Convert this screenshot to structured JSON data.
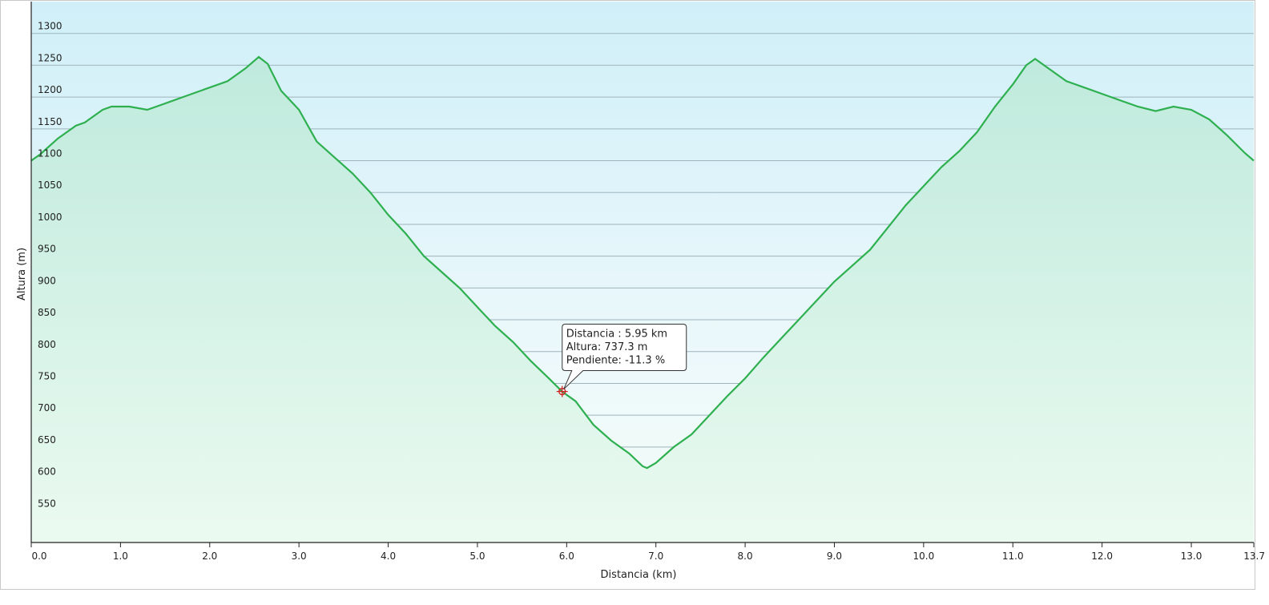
{
  "chart_data": {
    "type": "area",
    "title": "",
    "xlabel": "Distancia  (km)",
    "ylabel": "Altura (m)",
    "xlim": [
      0,
      13.7
    ],
    "ylim": [
      500,
      1350
    ],
    "x_ticks": [
      "0.0",
      "1.0",
      "2.0",
      "3.0",
      "4.0",
      "5.0",
      "6.0",
      "7.0",
      "8.0",
      "9.0",
      "10.0",
      "11.0",
      "12.0",
      "13.0",
      "13.7"
    ],
    "y_ticks": [
      "1300",
      "1250",
      "1200",
      "1150",
      "1100",
      "1050",
      "1000",
      "950",
      "900",
      "850",
      "800",
      "750",
      "700",
      "650",
      "600",
      "550"
    ],
    "grid": true,
    "line_color": "#2eb050",
    "series": [
      {
        "x": [
          0.0,
          0.1,
          0.3,
          0.5,
          0.6,
          0.8,
          0.9,
          1.0,
          1.1,
          1.3,
          1.5,
          1.7,
          2.0,
          2.2,
          2.4,
          2.55,
          2.65,
          2.8,
          3.0,
          3.2,
          3.4,
          3.6,
          3.8,
          4.0,
          4.2,
          4.4,
          4.6,
          4.8,
          5.0,
          5.2,
          5.4,
          5.6,
          5.8,
          5.95,
          6.1,
          6.3,
          6.5,
          6.7,
          6.85,
          6.9,
          7.0,
          7.2,
          7.4,
          7.6,
          7.8,
          8.0,
          8.2,
          8.4,
          8.6,
          8.8,
          9.0,
          9.2,
          9.4,
          9.6,
          9.8,
          10.0,
          10.2,
          10.4,
          10.6,
          10.8,
          11.0,
          11.15,
          11.25,
          11.4,
          11.6,
          11.8,
          12.0,
          12.2,
          12.4,
          12.6,
          12.8,
          13.0,
          13.2,
          13.4,
          13.6,
          13.7
        ],
        "y": [
          1100,
          1110,
          1135,
          1155,
          1160,
          1180,
          1185,
          1185,
          1185,
          1180,
          1190,
          1200,
          1215,
          1225,
          1245,
          1263,
          1252,
          1210,
          1180,
          1130,
          1105,
          1080,
          1050,
          1015,
          985,
          950,
          925,
          900,
          870,
          840,
          815,
          785,
          758,
          737,
          722,
          685,
          660,
          640,
          620,
          617,
          625,
          650,
          670,
          700,
          730,
          758,
          790,
          820,
          850,
          880,
          910,
          935,
          960,
          995,
          1030,
          1060,
          1090,
          1115,
          1145,
          1185,
          1220,
          1250,
          1260,
          1245,
          1225,
          1215,
          1205,
          1195,
          1185,
          1178,
          1185,
          1180,
          1165,
          1140,
          1112,
          1100
        ]
      }
    ],
    "annotations": {
      "marker": {
        "x": 5.95,
        "y": 737.3
      },
      "tooltip": {
        "line1": "Distancia  : 5.95 km",
        "line2": "Altura: 737.3 m",
        "line3": "Pendiente: -11.3 %"
      }
    }
  }
}
